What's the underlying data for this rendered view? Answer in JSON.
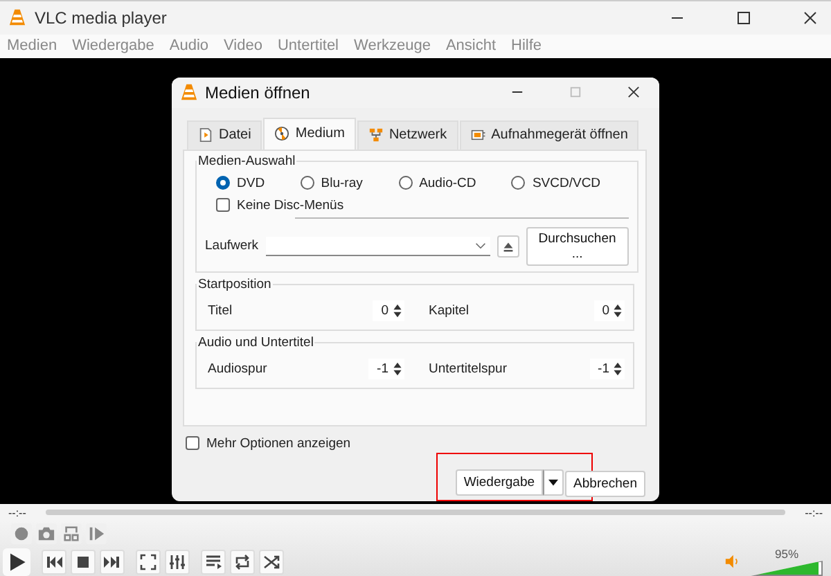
{
  "window": {
    "title": "VLC media player"
  },
  "menu": [
    "Medien",
    "Wiedergabe",
    "Audio",
    "Video",
    "Untertitel",
    "Werkzeuge",
    "Ansicht",
    "Hilfe"
  ],
  "dialog": {
    "title": "Medien öffnen",
    "tabs": [
      {
        "label": "Datei",
        "selected": false
      },
      {
        "label": "Medium",
        "selected": true
      },
      {
        "label": "Netzwerk",
        "selected": false
      },
      {
        "label": "Aufnahmegerät öffnen",
        "selected": false
      }
    ],
    "media_selection": {
      "title": "Medien-Auswahl",
      "radios": [
        {
          "label": "DVD",
          "selected": true
        },
        {
          "label": "Blu-ray",
          "selected": false
        },
        {
          "label": "Audio-CD",
          "selected": false
        },
        {
          "label": "SVCD/VCD",
          "selected": false
        }
      ],
      "no_disc_menus": {
        "label": "Keine Disc-Menüs",
        "checked": false
      },
      "drive_label": "Laufwerk",
      "browse_button": "Durchsuchen ..."
    },
    "groups": [
      {
        "title": "Startposition",
        "fields": [
          {
            "label": "Titel",
            "value": "0"
          },
          {
            "label": "Kapitel",
            "value": "0"
          }
        ]
      },
      {
        "title": "Audio und Untertitel",
        "fields": [
          {
            "label": "Audiospur",
            "value": "-1"
          },
          {
            "label": "Untertitelspur",
            "value": "-1"
          }
        ]
      }
    ],
    "more_options": {
      "label": "Mehr Optionen anzeigen",
      "checked": false
    },
    "play_button": "Wiedergabe",
    "cancel_button": "Abbrechen"
  },
  "player": {
    "time_elapsed": "--:--",
    "time_total": "--:--",
    "volume": {
      "level": 0.95,
      "reading": "95%"
    }
  }
}
